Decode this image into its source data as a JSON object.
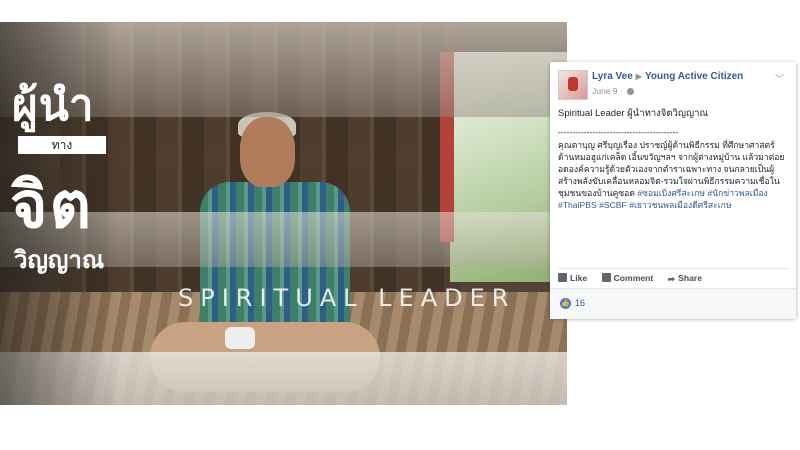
{
  "image": {
    "title_line1": "ผู้นำ",
    "title_tag": "ทาง",
    "title_line2": "จิต",
    "title_line3": "วิญญาณ",
    "title_en": "SPIRITUAL LEADER"
  },
  "post": {
    "author": "Lyra Vee",
    "page": "Young Active Citizen",
    "date": "June 9",
    "visibility_icon": "globe-icon",
    "options_icon": "chevron-down-icon",
    "title": "Spiritual Leader ผู้นำทางจิตวิญญาณ",
    "divider": "------------------------------------------",
    "paragraph": "คุณตาบุญ ศรีบุญเรือง ปราชญ์ผู้ด้านพิธีกรรม ที่ศึกษาศาสตร์ด้านหมอฮูแก่เคล็ด เอิ้นขวัญฯลฯ จากผู้ต่างหมู่บ้าน แล้วมาต่อยอดองค์ความรู้ด้วยตัวเองจากตำราเฉพาะทาง จนกลายเป็นผู้สร้างพลังขับเคลื่อนหลอมจิต-รวมใจผ่านพิธีกรรมความเชื่อในชุมชนของบ้านคูซอด",
    "hashtags": [
      "#ซอมเบิ่งศรีสะเกษ",
      "#นักข่าวพลเมือง",
      "#ThaiPBS",
      "#SCBF",
      "#เยาวชนพลเมืองดีศรีสะเกษ"
    ],
    "actions": {
      "like": "Like",
      "comment": "Comment",
      "share": "Share"
    },
    "reaction_count": "16"
  },
  "colors": {
    "link": "#365899",
    "like_blue": "#4a76e8"
  }
}
